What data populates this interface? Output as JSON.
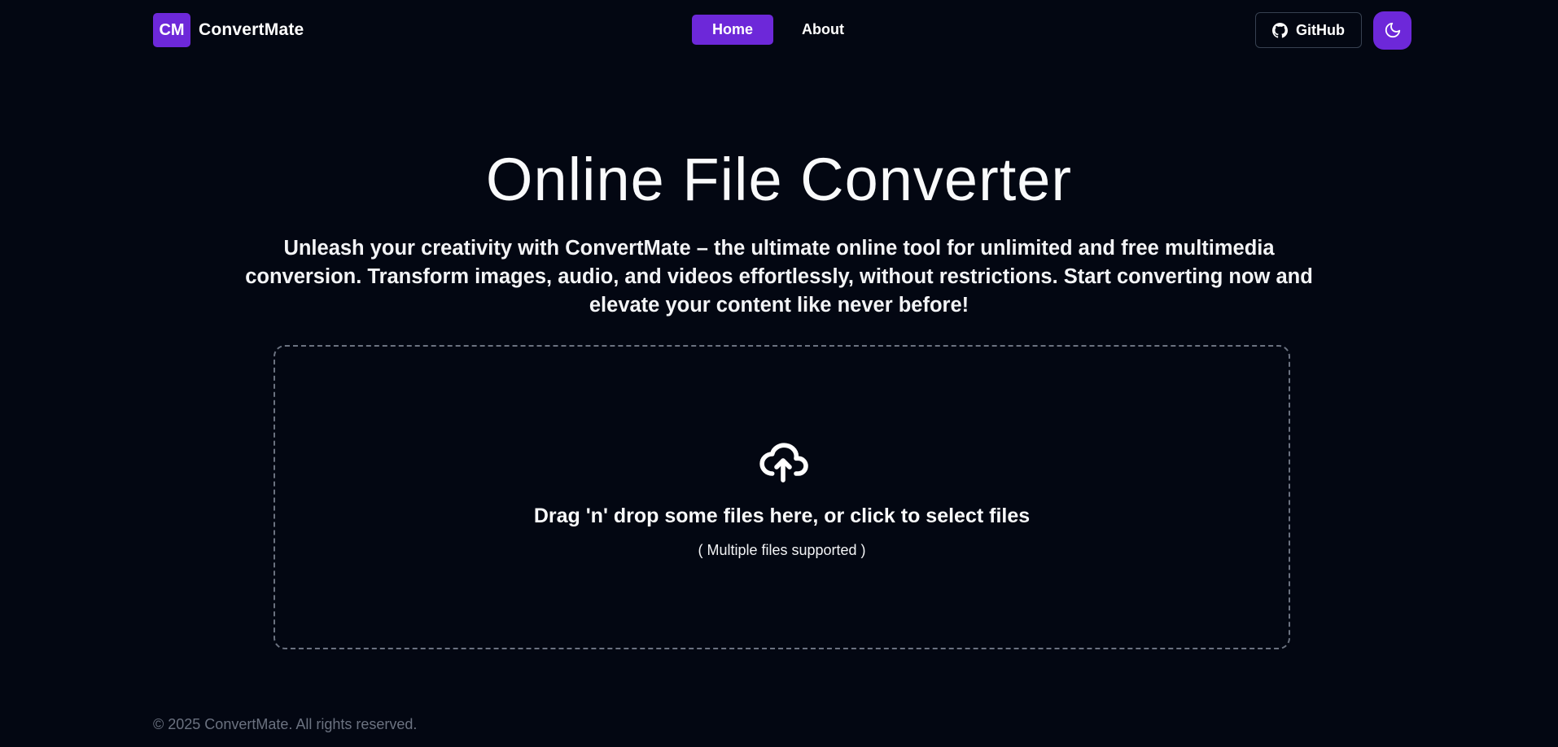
{
  "brand": {
    "badge": "CM",
    "name": "ConvertMate"
  },
  "nav": {
    "items": [
      {
        "label": "Home",
        "active": true
      },
      {
        "label": "About",
        "active": false
      }
    ]
  },
  "actions": {
    "github_label": "GitHub",
    "github_icon": "github-icon",
    "theme_icon": "moon-icon"
  },
  "hero": {
    "title": "Online File Converter",
    "subtitle": "Unleash your creativity with ConvertMate – the ultimate online tool for unlimited and free multimedia conversion. Transform images, audio, and videos effortlessly, without restrictions. Start converting now and elevate your content like never before!"
  },
  "dropzone": {
    "icon": "cloud-upload-icon",
    "title": "Drag 'n' drop some files here, or click to select files",
    "hint": "( Multiple files supported )"
  },
  "footer": {
    "copyright": "© 2025 ConvertMate. All rights reserved."
  },
  "colors": {
    "background": "#030712",
    "accent": "#6d28d9",
    "text": "#f9fafb",
    "muted": "#6b7280"
  }
}
